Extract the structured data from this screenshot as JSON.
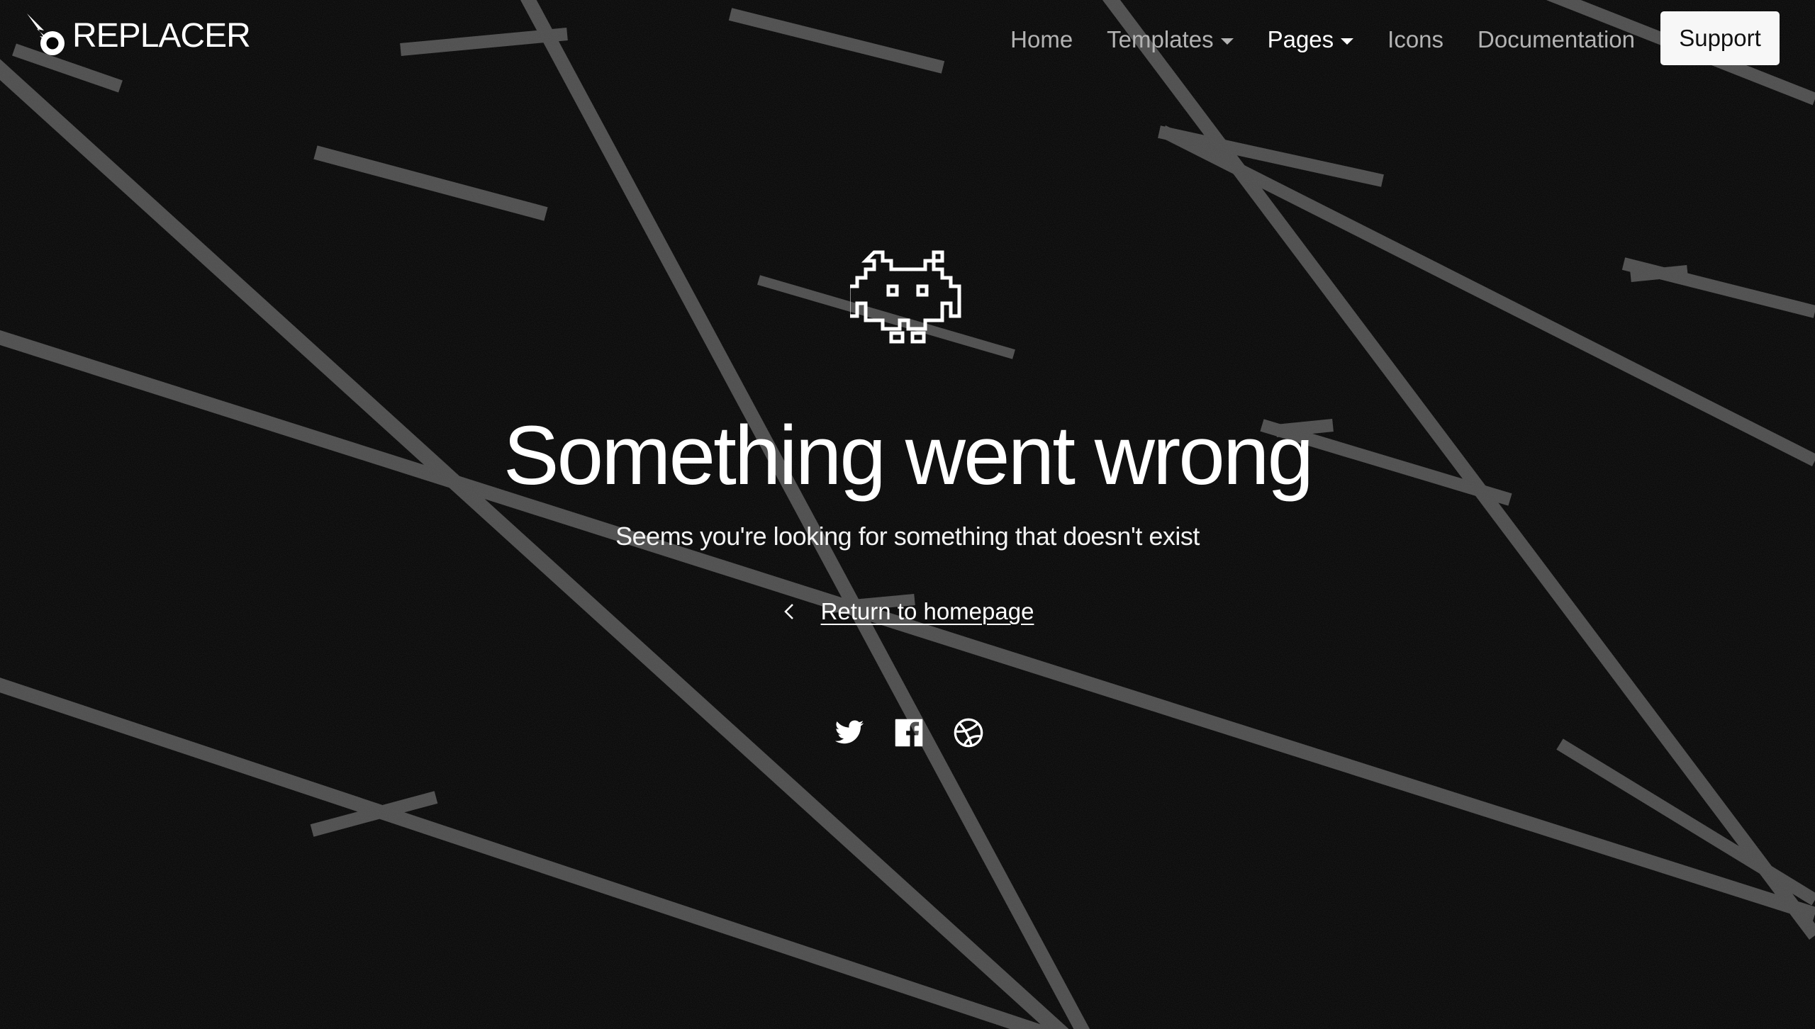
{
  "brand": {
    "name": "REPLACER",
    "logo_icon": "comet-icon"
  },
  "nav": {
    "items": [
      {
        "label": "Home",
        "dropdown": false,
        "active": false
      },
      {
        "label": "Templates",
        "dropdown": true,
        "active": false
      },
      {
        "label": "Pages",
        "dropdown": true,
        "active": true
      },
      {
        "label": "Icons",
        "dropdown": false,
        "active": false
      },
      {
        "label": "Documentation",
        "dropdown": false,
        "active": false
      }
    ],
    "support_label": "Support"
  },
  "hero": {
    "icon": "space-invader-icon",
    "title": "Something went wrong",
    "subtitle": "Seems you're looking for something that doesn't exist",
    "return_label": "Return to homepage",
    "return_icon": "chevron-left-icon"
  },
  "social": [
    {
      "name": "twitter-icon"
    },
    {
      "name": "facebook-icon"
    },
    {
      "name": "dribbble-icon"
    }
  ],
  "colors": {
    "background": "#050505",
    "line": "#6b6b6b",
    "text": "#ffffff",
    "nav_muted": "#b3b3b3",
    "button_bg": "#f7f7f7"
  }
}
